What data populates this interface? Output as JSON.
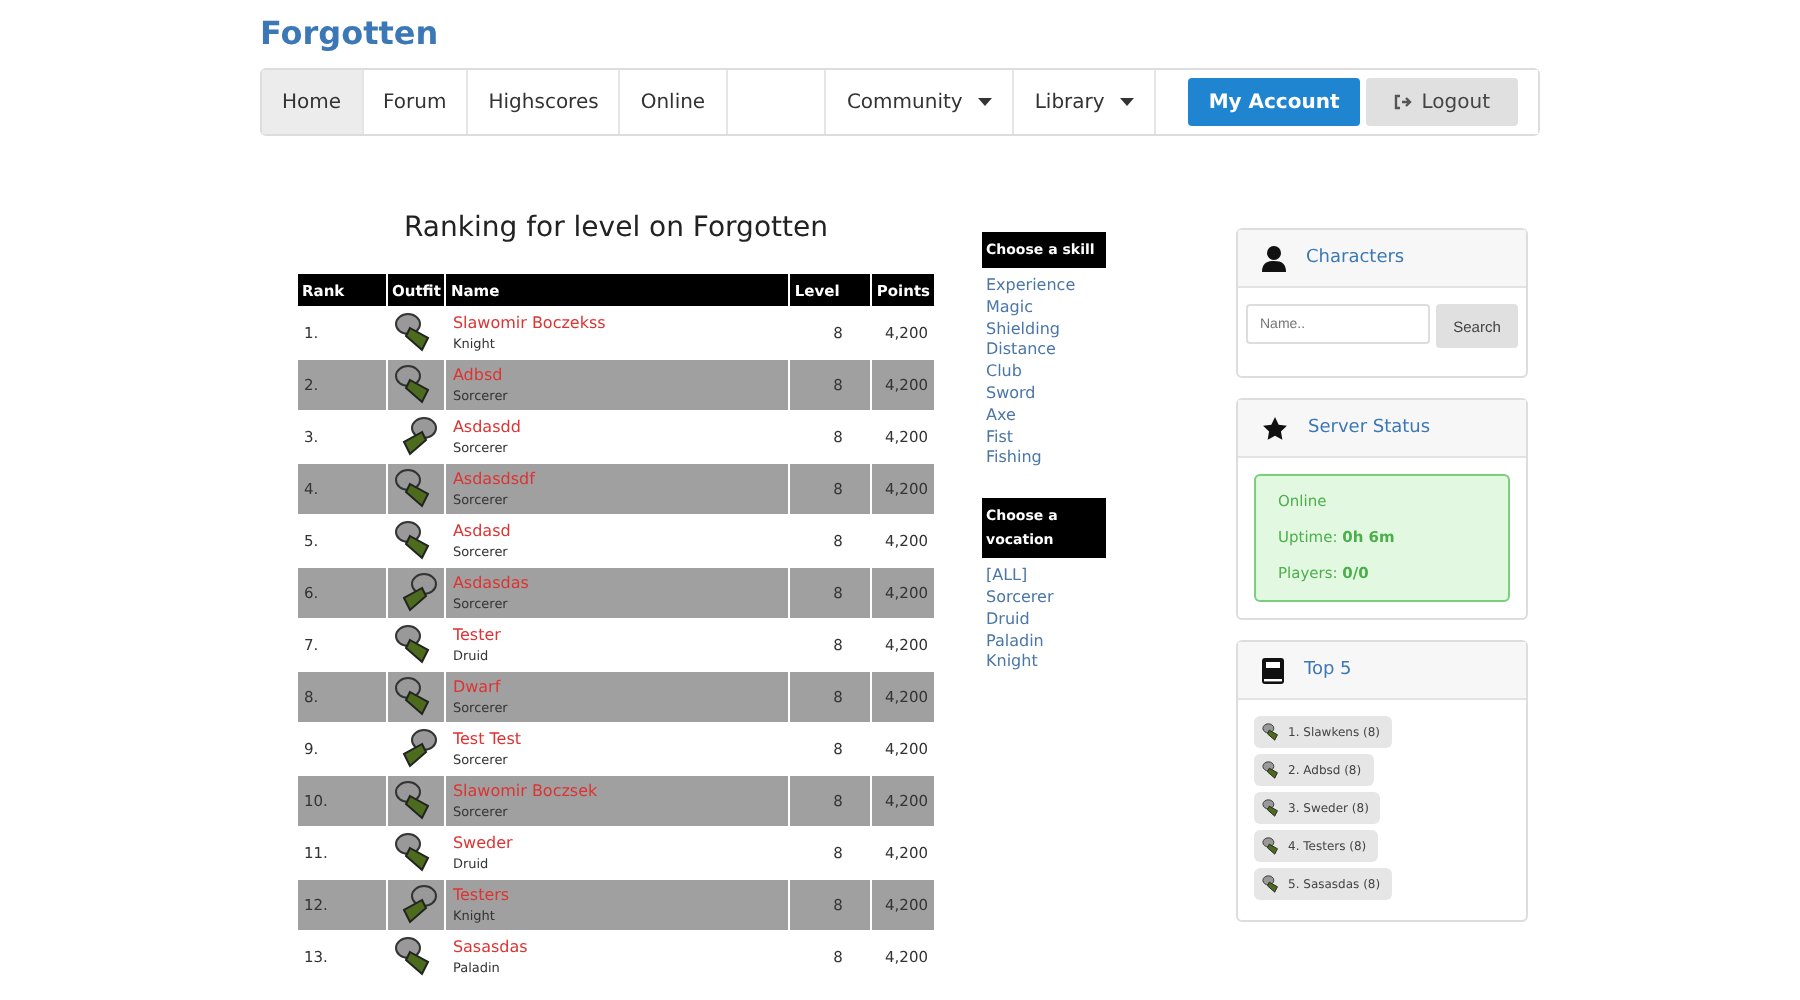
{
  "brand": "Forgotten",
  "nav": [
    {
      "label": "Home",
      "selected": true
    },
    {
      "label": "Forum",
      "selected": false
    },
    {
      "label": "Highscores",
      "selected": false
    },
    {
      "label": "Online",
      "selected": false
    }
  ],
  "nav_right": [
    {
      "label": "Community",
      "dropdown": true
    },
    {
      "label": "Library",
      "dropdown": true
    }
  ],
  "account_button": "My Account",
  "logout_button": "Logout",
  "ranking": {
    "title": "Ranking for level on Forgotten",
    "columns": [
      "Rank",
      "Outfit",
      "Name",
      "Level",
      "Points"
    ],
    "rows": [
      {
        "rank": "1.",
        "name": "Slawomir Boczekss",
        "vocation": "Knight",
        "level": "8",
        "points": "4,200"
      },
      {
        "rank": "2.",
        "name": "Adbsd",
        "vocation": "Sorcerer",
        "level": "8",
        "points": "4,200"
      },
      {
        "rank": "3.",
        "name": "Asdasdd",
        "vocation": "Sorcerer",
        "level": "8",
        "points": "4,200"
      },
      {
        "rank": "4.",
        "name": "Asdasdsdf",
        "vocation": "Sorcerer",
        "level": "8",
        "points": "4,200"
      },
      {
        "rank": "5.",
        "name": "Asdasd",
        "vocation": "Sorcerer",
        "level": "8",
        "points": "4,200"
      },
      {
        "rank": "6.",
        "name": "Asdasdas",
        "vocation": "Sorcerer",
        "level": "8",
        "points": "4,200"
      },
      {
        "rank": "7.",
        "name": "Tester",
        "vocation": "Druid",
        "level": "8",
        "points": "4,200"
      },
      {
        "rank": "8.",
        "name": "Dwarf",
        "vocation": "Sorcerer",
        "level": "8",
        "points": "4,200"
      },
      {
        "rank": "9.",
        "name": "Test Test",
        "vocation": "Sorcerer",
        "level": "8",
        "points": "4,200"
      },
      {
        "rank": "10.",
        "name": "Slawomir Boczsek",
        "vocation": "Sorcerer",
        "level": "8",
        "points": "4,200"
      },
      {
        "rank": "11.",
        "name": "Sweder",
        "vocation": "Druid",
        "level": "8",
        "points": "4,200"
      },
      {
        "rank": "12.",
        "name": "Testers",
        "vocation": "Knight",
        "level": "8",
        "points": "4,200"
      },
      {
        "rank": "13.",
        "name": "Sasasdas",
        "vocation": "Paladin",
        "level": "8",
        "points": "4,200"
      }
    ]
  },
  "skills": {
    "title": "Choose a skill",
    "items": [
      "Experience",
      "Magic",
      "Shielding",
      "Distance",
      "Club",
      "Sword",
      "Axe",
      "Fist",
      "Fishing"
    ]
  },
  "vocations": {
    "title": "Choose a vocation",
    "items": [
      "[ALL]",
      "Sorcerer",
      "Druid",
      "Paladin",
      "Knight"
    ]
  },
  "characters": {
    "title": "Characters",
    "placeholder": "Name..",
    "button": "Search"
  },
  "server_status": {
    "title": "Server Status",
    "lines": [
      "Online",
      "Uptime: **0h 6m**",
      "Players: **0/0**"
    ]
  },
  "top5": {
    "title": "Top 5",
    "items": [
      "1. Slawkens (8)",
      "2. Adbsd (8)",
      "3. Sweder (8)",
      "4. Testers (8)",
      "5. Sasasdas (8)"
    ]
  }
}
